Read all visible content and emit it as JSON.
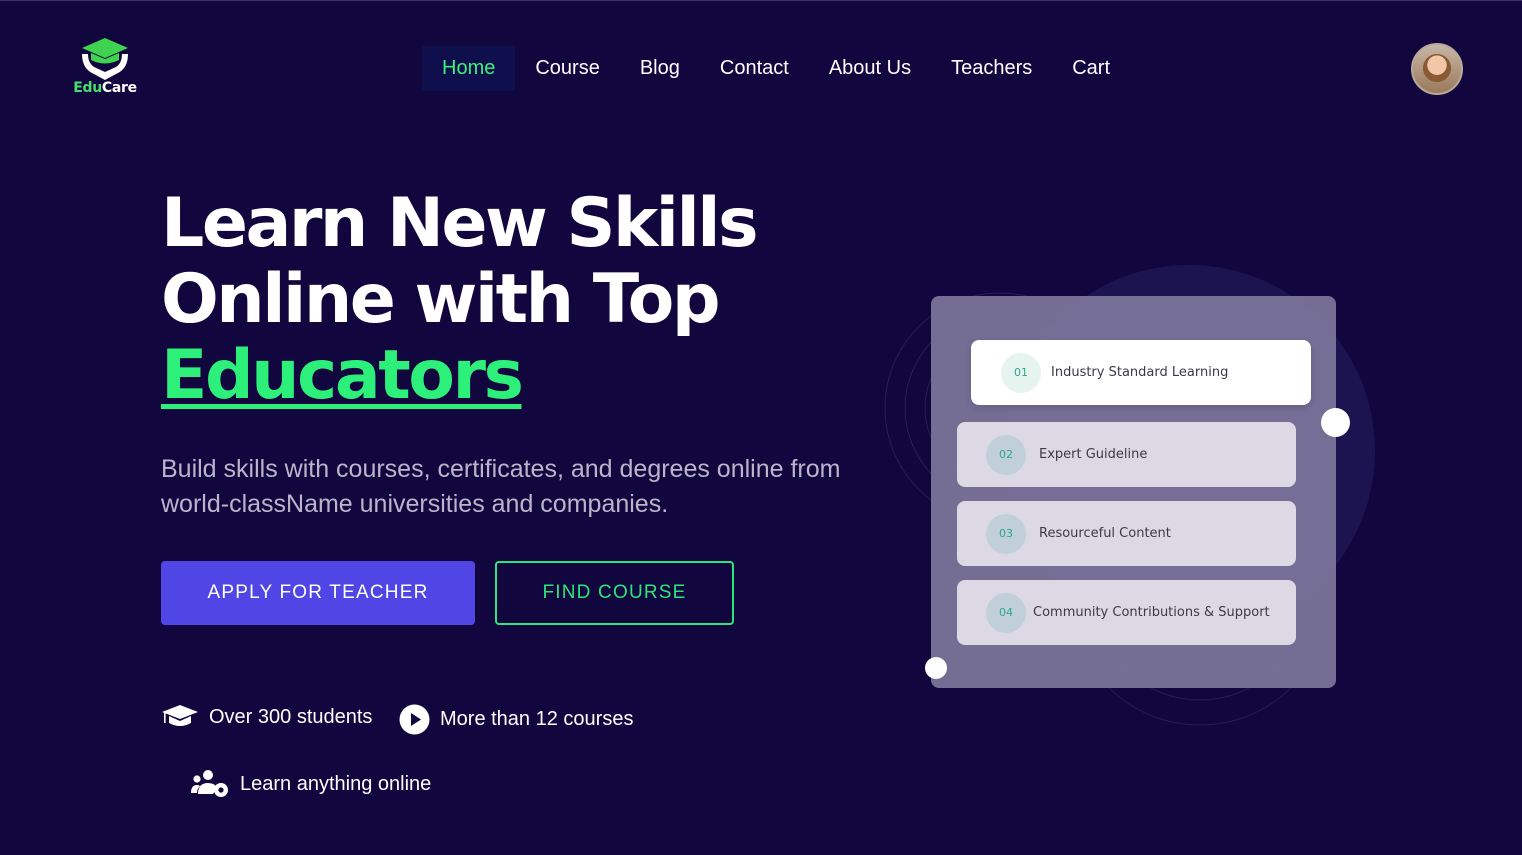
{
  "logo": {
    "text_part1": "Edu",
    "text_part2": "Care",
    "icon": "graduation-hands-icon"
  },
  "nav": {
    "items": [
      {
        "label": "Home",
        "active": true
      },
      {
        "label": "Course",
        "active": false
      },
      {
        "label": "Blog",
        "active": false
      },
      {
        "label": "Contact",
        "active": false
      },
      {
        "label": "About Us",
        "active": false
      },
      {
        "label": "Teachers",
        "active": false
      },
      {
        "label": "Cart",
        "active": false
      }
    ]
  },
  "hero": {
    "title_line1": "Learn New Skills",
    "title_line2": "Online with Top",
    "title_highlight": "Educators",
    "subtitle": "Build skills with courses, certificates, and degrees online from world-className universities and companies.",
    "primary_button": "APPLY FOR TEACHER",
    "secondary_button": "FIND COURSE"
  },
  "stats": [
    {
      "icon": "graduation-cap-icon",
      "label": "Over 300 students"
    },
    {
      "icon": "play-circle-icon",
      "label": "More than 12 courses"
    },
    {
      "icon": "users-cog-icon",
      "label": "Learn anything online"
    }
  ],
  "features": [
    {
      "num": "01",
      "label": "Industry Standard Learning"
    },
    {
      "num": "02",
      "label": "Expert Guideline"
    },
    {
      "num": "03",
      "label": "Resourceful Content"
    },
    {
      "num": "04",
      "label": "Community Contributions & Support"
    }
  ],
  "colors": {
    "background": "#12063f",
    "accent_green": "#2df07a",
    "primary_button": "#5046e6",
    "panel": "#797299"
  }
}
